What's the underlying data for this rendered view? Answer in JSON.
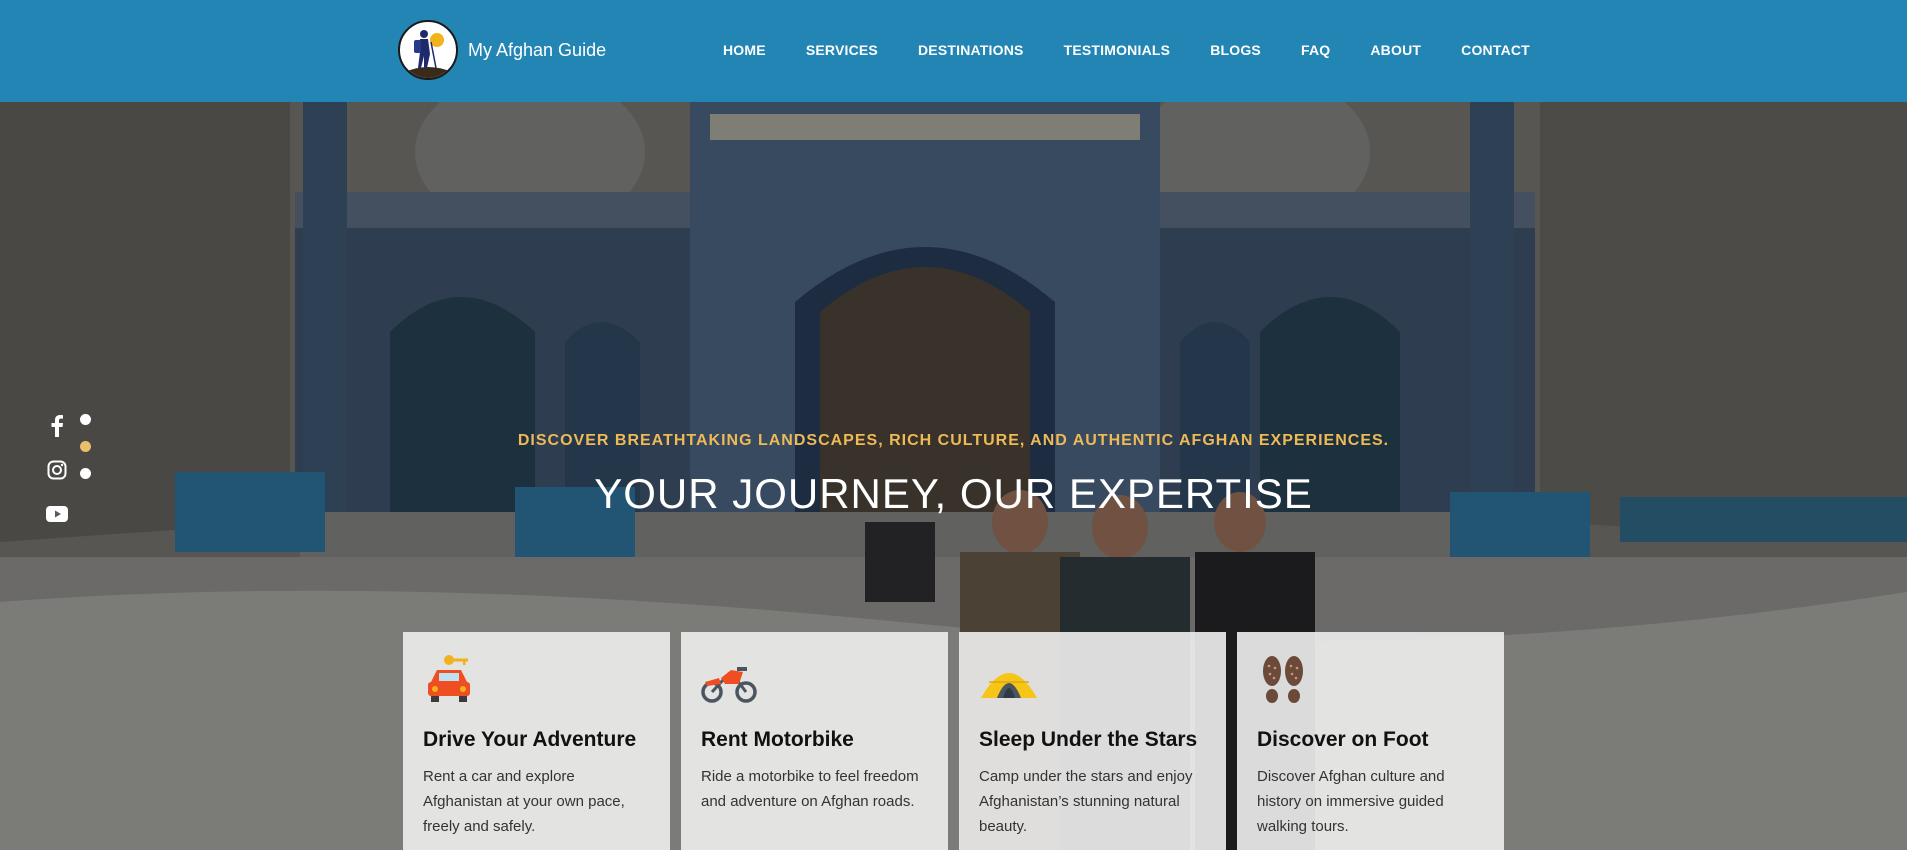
{
  "header": {
    "brand": "My Afghan Guide",
    "nav": [
      "HOME",
      "SERVICES",
      "DESTINATIONS",
      "TESTIMONIALS",
      "BLOGS",
      "FAQ",
      "ABOUT",
      "CONTACT"
    ]
  },
  "hero": {
    "tagline": "DISCOVER BREATHTAKING LANDSCAPES, RICH CULTURE, AND AUTHENTIC AFGHAN EXPERIENCES.",
    "headline": "YOUR JOURNEY, OUR EXPERTISE",
    "slider_active_index": 1,
    "slider_count": 3
  },
  "social": [
    "facebook-icon",
    "instagram-icon",
    "youtube-icon"
  ],
  "cards": [
    {
      "icon": "car-key-icon",
      "title": "Drive Your Adventure",
      "desc": "Rent a car and explore Afghanistan at your own pace, freely and safely."
    },
    {
      "icon": "motorbike-icon",
      "title": "Rent Motorbike",
      "desc": "Ride a motorbike to feel freedom and adventure on Afghan roads."
    },
    {
      "icon": "tent-icon",
      "title": "Sleep Under the Stars",
      "desc": "Camp under the stars and enjoy Afghanistan’s stunning natural beauty."
    },
    {
      "icon": "footprints-icon",
      "title": "Discover on Foot",
      "desc": "Discover Afghan culture and history on immersive guided walking tours."
    }
  ],
  "colors": {
    "header_bg": "#2385b3",
    "tagline": "#eeb957",
    "dot_active": "#e8c06a"
  }
}
